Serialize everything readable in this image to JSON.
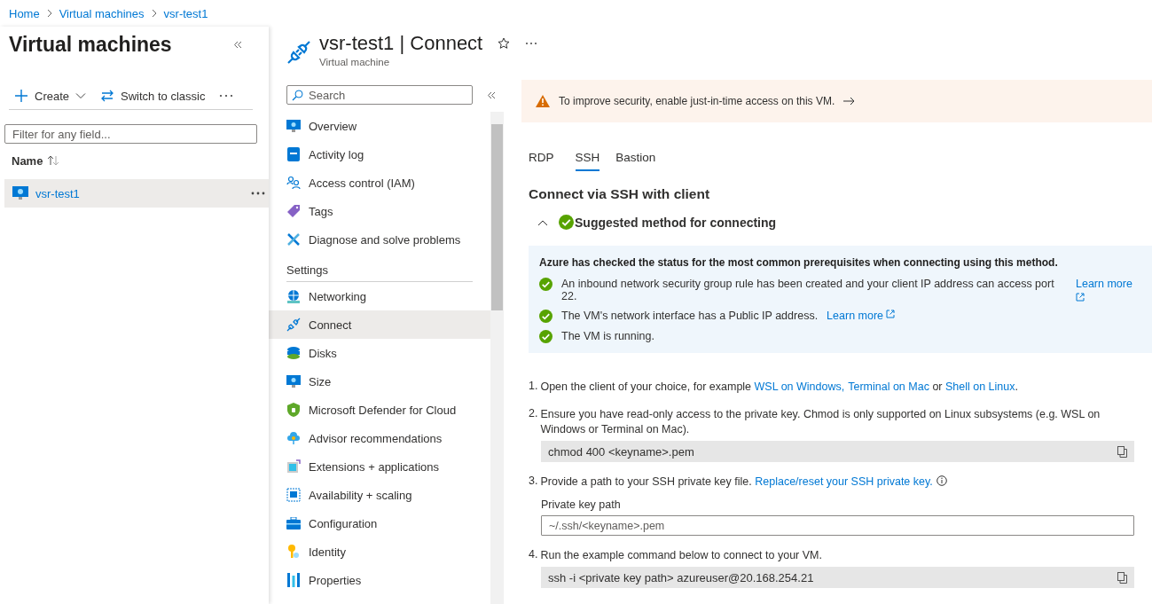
{
  "breadcrumb": [
    "Home",
    "Virtual machines",
    "vsr-test1"
  ],
  "list_pane": {
    "title": "Virtual machines",
    "create_label": "Create",
    "switch_label": "Switch to classic",
    "filter_placeholder": "Filter for any field...",
    "column": "Name",
    "rows": [
      {
        "name": "vsr-test1",
        "selected": true
      }
    ]
  },
  "blade": {
    "title": "vsr-test1 | Connect",
    "subtitle": "Virtual machine",
    "search_placeholder": "Search"
  },
  "nav": [
    {
      "items": [
        {
          "kind": "monitor",
          "label": "Overview",
          "selected": false
        },
        {
          "kind": "book",
          "label": "Activity log",
          "selected": false
        },
        {
          "kind": "people",
          "label": "Access control (IAM)",
          "selected": false
        },
        {
          "kind": "tag",
          "label": "Tags",
          "selected": false
        },
        {
          "kind": "tools",
          "label": "Diagnose and solve problems",
          "selected": false
        }
      ]
    },
    {
      "heading": "Settings",
      "items": [
        {
          "kind": "network",
          "label": "Networking",
          "selected": false
        },
        {
          "kind": "plug",
          "label": "Connect",
          "selected": true
        },
        {
          "kind": "disks",
          "label": "Disks",
          "selected": false
        },
        {
          "kind": "monitor",
          "label": "Size",
          "selected": false
        },
        {
          "kind": "shield",
          "label": "Microsoft Defender for Cloud",
          "selected": false
        },
        {
          "kind": "cloud",
          "label": "Advisor recommendations",
          "selected": false
        },
        {
          "kind": "extension",
          "label": "Extensions + applications",
          "selected": false
        },
        {
          "kind": "scaling",
          "label": "Availability + scaling",
          "selected": false
        },
        {
          "kind": "briefcase",
          "label": "Configuration",
          "selected": false
        },
        {
          "kind": "key",
          "label": "Identity",
          "selected": false
        },
        {
          "kind": "bars",
          "label": "Properties",
          "selected": false
        }
      ]
    }
  ],
  "banner": {
    "text": "To improve security, enable just-in-time access on this VM."
  },
  "tabs": [
    {
      "label": "RDP",
      "selected": false
    },
    {
      "label": "SSH",
      "selected": true
    },
    {
      "label": "Bastion",
      "selected": false
    }
  ],
  "heading": "Connect via SSH with client",
  "section": {
    "title": "Suggested method for connecting",
    "expanded": true
  },
  "checks": {
    "intro": "Azure has checked the status for the most common prerequisites when connecting using this method.",
    "items": [
      {
        "text": "An inbound network security group rule has been created and your client IP address can access port 22.",
        "link": "Learn more"
      },
      {
        "text": "The VM's network interface has a Public IP address.",
        "link": "Learn more"
      },
      {
        "text": "The VM is running."
      }
    ]
  },
  "steps": [
    {
      "number": "1.",
      "parts": [
        {
          "kind": "text",
          "text": "Open the client of your choice, for example "
        },
        {
          "kind": "link",
          "text": "WSL on Windows,"
        },
        {
          "kind": "link",
          "text": "Terminal on Mac"
        },
        {
          "kind": "text",
          "text": " or "
        },
        {
          "kind": "link",
          "text": "Shell on Linux"
        },
        {
          "kind": "text",
          "text": "."
        }
      ]
    },
    {
      "number": "2.",
      "parts": [
        {
          "kind": "text",
          "text": "Ensure you have read-only access to the private key. Chmod is only supported on Linux subsystems (e.g. WSL on Windows or Terminal on Mac)."
        }
      ],
      "code": "chmod 400 <keyname>.pem"
    },
    {
      "number": "3.",
      "parts": [
        {
          "kind": "text",
          "text": "Provide a path to your SSH private key file. "
        },
        {
          "kind": "link",
          "text": "Replace/reset your SSH private key."
        }
      ],
      "info_icon": true,
      "field": {
        "label": "Private key path",
        "placeholder": "~/.ssh/<keyname>.pem"
      }
    },
    {
      "number": "4.",
      "parts": [
        {
          "kind": "text",
          "text": "Run the example command below to connect to your VM."
        }
      ],
      "code": "ssh -i <private key path> azureuser@20.168.254.21"
    }
  ]
}
